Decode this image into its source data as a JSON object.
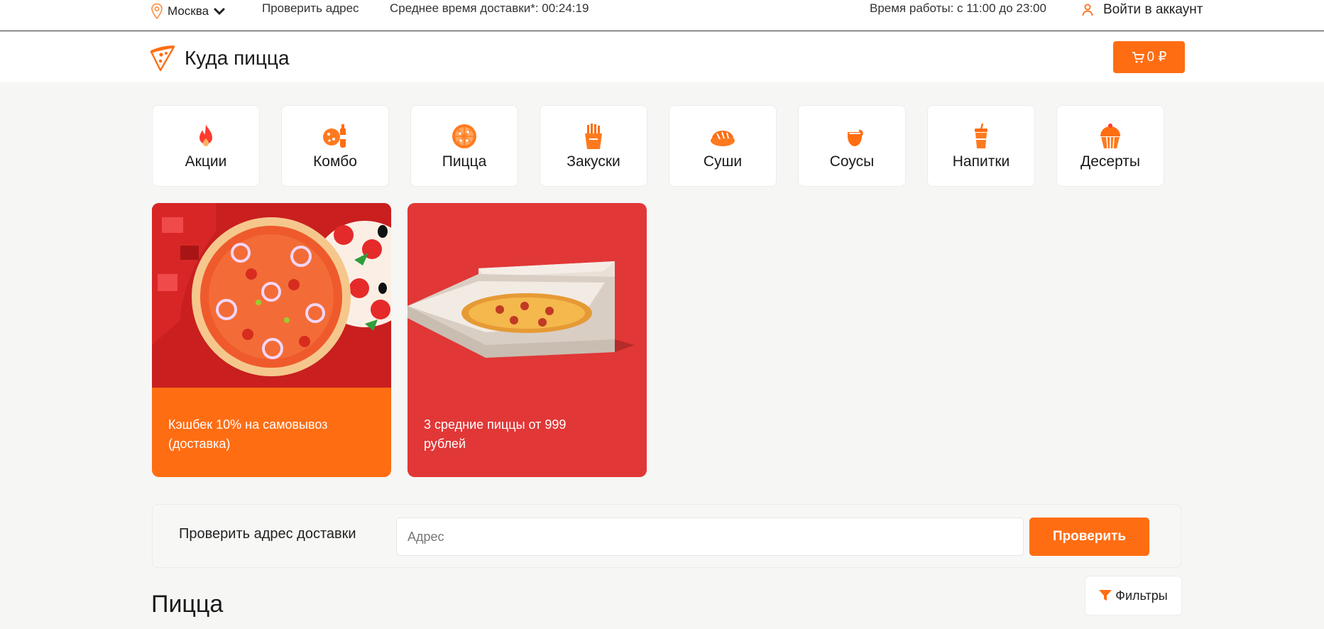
{
  "topbar": {
    "city": "Москва",
    "check_address_link": "Проверить адрес",
    "delivery_time": "Среднее время доставки*: 00:24:19",
    "working_hours": "Время работы: с 11:00 до 23:00",
    "login": "Войти в аккаунт"
  },
  "header": {
    "logo_text": "Куда пицца",
    "cart_label": "0 ₽"
  },
  "categories": [
    {
      "label": "Акции",
      "icon": "fire-icon"
    },
    {
      "label": "Комбо",
      "icon": "combo-icon"
    },
    {
      "label": "Пицца",
      "icon": "pizza-icon"
    },
    {
      "label": "Закуски",
      "icon": "fries-icon"
    },
    {
      "label": "Суши",
      "icon": "sushi-icon"
    },
    {
      "label": "Соусы",
      "icon": "sauce-icon"
    },
    {
      "label": "Напитки",
      "icon": "drink-icon"
    },
    {
      "label": "Десерты",
      "icon": "cupcake-icon"
    }
  ],
  "promos": [
    {
      "text": "Кэшбек 10% на самовывоз (доставка)",
      "color": "#ff6d13"
    },
    {
      "text": "3 средние пиццы от 999 рублей",
      "color": "#e13737"
    }
  ],
  "address_check": {
    "label": "Проверить адрес доставки",
    "placeholder": "Адрес",
    "button": "Проверить"
  },
  "section": {
    "title": "Пицца",
    "filters_label": "Фильтры"
  },
  "colors": {
    "accent": "#ff6d13",
    "promo_red": "#e13737"
  }
}
